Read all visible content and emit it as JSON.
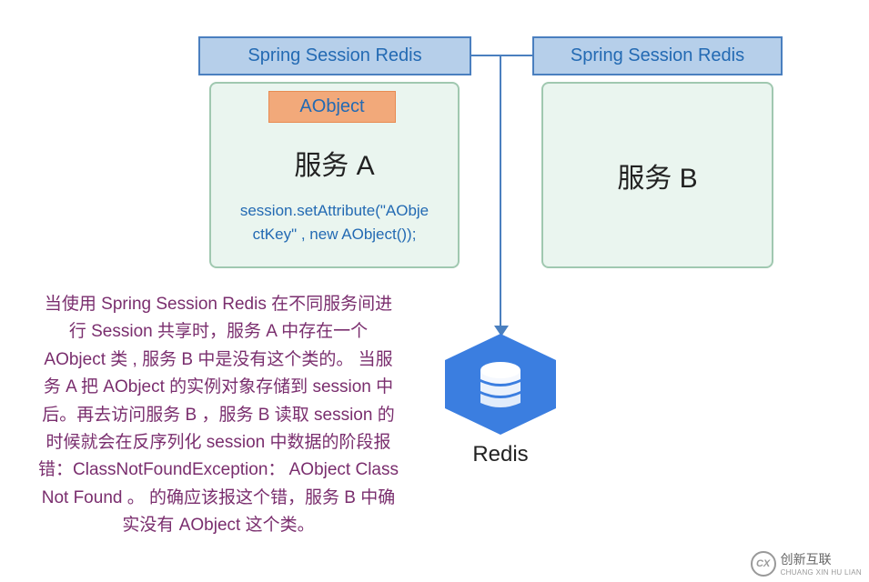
{
  "headers": {
    "a": "Spring Session Redis",
    "b": "Spring Session Redis"
  },
  "aobject_tag": "AObject",
  "services": {
    "a": {
      "title": "服务 A",
      "code_line1": "session.setAttribute(\"AObje",
      "code_line2": "ctKey\" , new AObject());"
    },
    "b": {
      "title": "服务 B"
    }
  },
  "description": "当使用 Spring Session Redis 在不同服务间进行 Session 共享时，服务 A 中存在一个 AObject 类 , 服务 B 中是没有这个类的。 当服务 A 把 AObject 的实例对象存储到 session 中后。再去访问服务 B ，服务 B 读取 session 的时候就会在反序列化 session 中数据的阶段报错：ClassNotFoundException： AObject Class Not Found 。 的确应该报这个错，服务 B 中确实没有 AObject 这个类。",
  "redis_label": "Redis",
  "watermark": {
    "main": "创新互联",
    "sub": "CHUANG XIN HU LIAN"
  },
  "colors": {
    "header_bg": "#b6cfea",
    "header_border": "#4a7fbf",
    "header_text": "#236ab3",
    "box_bg": "#eaf5ef",
    "box_border": "#a0c8b0",
    "tag_bg": "#f2a97a",
    "desc_text": "#7a2e6e",
    "redis_hex": "#3b7ee0"
  }
}
